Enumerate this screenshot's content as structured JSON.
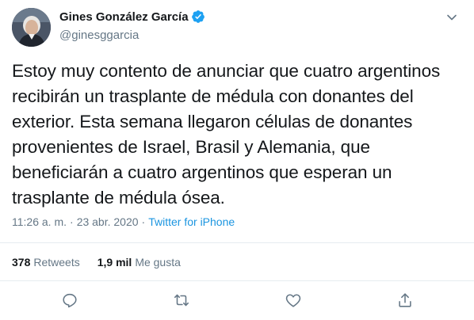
{
  "author": {
    "name": "Gines González García",
    "handle": "@ginesggarcia",
    "verified": true
  },
  "tweet": {
    "text": "Estoy muy contento de anunciar que cuatro argentinos recibirán un trasplante de médula con donantes del exterior. Esta semana llegaron células de donantes provenientes de Israel, Brasil y Alemania, que beneficiarán a cuatro argentinos que esperan un trasplante de médula ósea.",
    "time": "11:26 a. m.",
    "date": "23 abr. 2020",
    "separator": "·",
    "source": "Twitter for iPhone"
  },
  "stats": {
    "retweets_count": "378",
    "retweets_label": "Retweets",
    "likes_count": "1,9 mil",
    "likes_label": "Me gusta"
  },
  "icons": {
    "verified": "verified-badge-icon",
    "menu": "chevron-down-icon",
    "reply": "reply-icon",
    "retweet": "retweet-icon",
    "like": "heart-icon",
    "share": "share-icon"
  },
  "colors": {
    "accent": "#1da1f2",
    "link": "#1b95e0",
    "muted": "#657786",
    "text": "#14171a",
    "divider": "#e6ecf0"
  }
}
